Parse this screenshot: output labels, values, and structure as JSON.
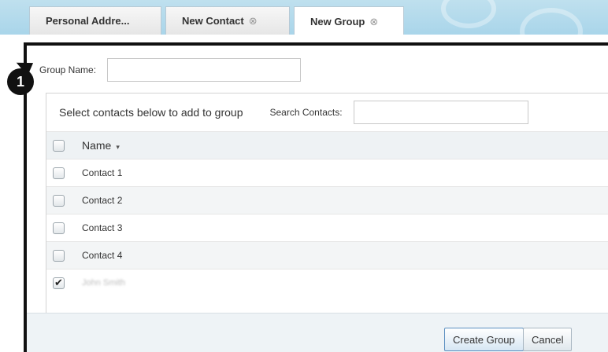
{
  "tabs": [
    {
      "label": "Personal Addre...",
      "closable": false
    },
    {
      "label": "New Contact",
      "closable": true
    },
    {
      "label": "New Group",
      "closable": true,
      "active": true
    }
  ],
  "close_glyph": "⊗",
  "callout": {
    "number": "1"
  },
  "group": {
    "label": "Group Name:",
    "value": "",
    "placeholder": ""
  },
  "contacts_header": {
    "instruction": "Select contacts below to add to group",
    "search_label": "Search Contacts:",
    "search_value": ""
  },
  "table": {
    "column_name": "Name",
    "sort_indicator": "▾",
    "rows": [
      {
        "name": "Contact 1",
        "checked": false
      },
      {
        "name": "Contact 2",
        "checked": false
      },
      {
        "name": "Contact 3",
        "checked": false
      },
      {
        "name": "Contact 4",
        "checked": false
      },
      {
        "name": "John Smith",
        "checked": true,
        "obscured": true
      }
    ]
  },
  "buttons": {
    "create": "Create Group",
    "cancel": "Cancel"
  },
  "colors": {
    "tabbar": "#a9d5ea",
    "frame": "#111111",
    "alt_row": "#f3f5f6"
  }
}
